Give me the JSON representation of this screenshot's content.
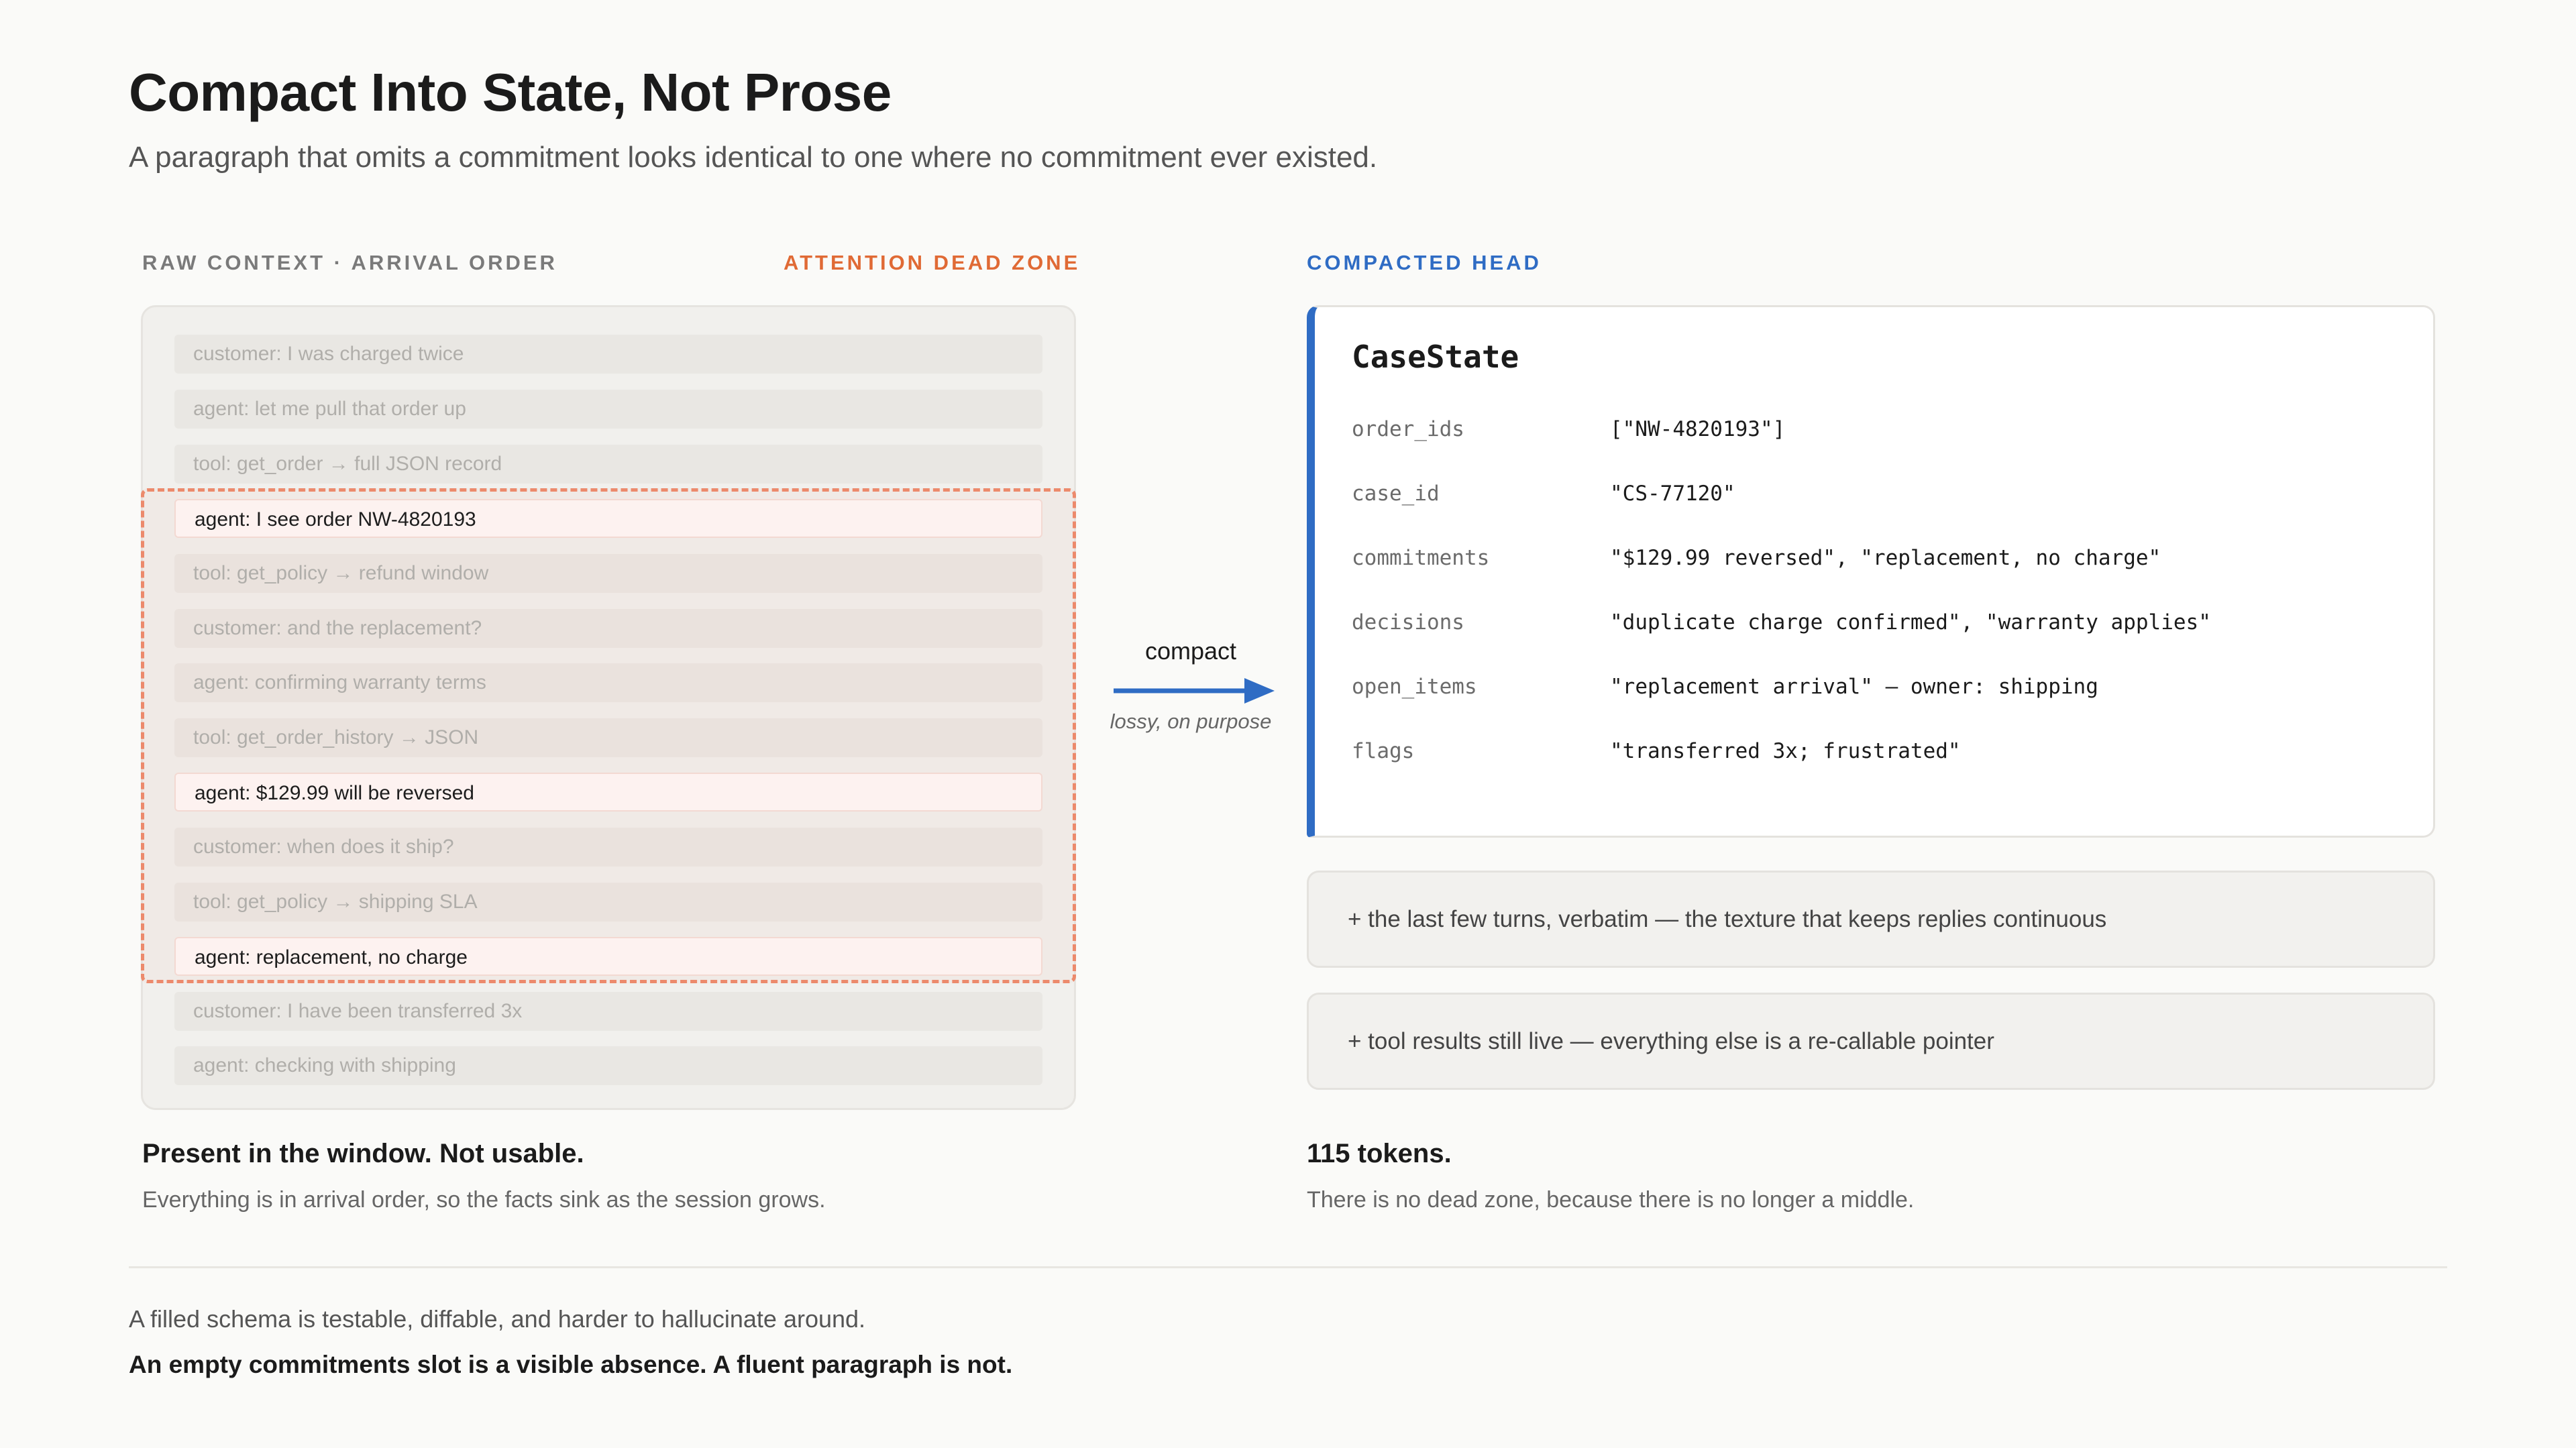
{
  "header": {
    "title": "Compact Into State, Not Prose",
    "subtitle": "A paragraph that omits a commitment looks identical to one where no commitment ever existed."
  },
  "labels": {
    "raw_context": "RAW CONTEXT · ARRIVAL ORDER",
    "dead_zone": "ATTENTION DEAD ZONE",
    "compacted_head": "COMPACTED HEAD"
  },
  "raw_rows": [
    {
      "text": "customer: I was charged twice",
      "state": "faded"
    },
    {
      "text": "agent: let me pull that order up",
      "state": "faded"
    },
    {
      "text": "tool: get_order → full JSON record",
      "state": "faded"
    },
    {
      "text": "agent: I see order NW-4820193",
      "state": "highlight"
    },
    {
      "text": "tool: get_policy → refund window",
      "state": "dead"
    },
    {
      "text": "customer: and the replacement?",
      "state": "dead"
    },
    {
      "text": "agent: confirming warranty terms",
      "state": "dead"
    },
    {
      "text": "tool: get_order_history → JSON",
      "state": "dead"
    },
    {
      "text": "agent: $129.99 will be reversed",
      "state": "highlight"
    },
    {
      "text": "customer: when does it ship?",
      "state": "dead"
    },
    {
      "text": "tool: get_policy → shipping SLA",
      "state": "dead"
    },
    {
      "text": "agent: replacement, no charge",
      "state": "highlight"
    },
    {
      "text": "customer: I have been transferred 3x",
      "state": "faded"
    },
    {
      "text": "agent: checking with shipping",
      "state": "faded"
    }
  ],
  "arrow": {
    "label": "compact",
    "note": "lossy, on purpose"
  },
  "case_state": {
    "title": "CaseState",
    "fields": [
      {
        "key": "order_ids",
        "value": "[\"NW-4820193\"]"
      },
      {
        "key": "case_id",
        "value": "\"CS-77120\""
      },
      {
        "key": "commitments",
        "value": "\"$129.99 reversed\", \"replacement, no charge\""
      },
      {
        "key": "decisions",
        "value": "\"duplicate charge confirmed\", \"warranty applies\""
      },
      {
        "key": "open_items",
        "value": "\"replacement arrival\" — owner: shipping"
      },
      {
        "key": "flags",
        "value": "\"transferred 3x; frustrated\""
      }
    ]
  },
  "extras": [
    "+ the last few turns, verbatim — the texture that keeps replies continuous",
    "+ tool results still live — everything else is a re-callable pointer"
  ],
  "captions": {
    "left_bold": "Present in the window. Not usable.",
    "left_sub": "Everything is in arrival order, so the facts sink as the session grows.",
    "right_bold": "115 tokens.",
    "right_sub": "There is no dead zone, because there is no longer a middle."
  },
  "footer": {
    "line1": "A filled schema is testable, diffable, and harder to hallucinate around.",
    "line2": "An empty commitments slot is a visible absence. A fluent paragraph is not."
  },
  "colors": {
    "accent_blue": "#2f6cc4",
    "dead_zone_orange": "#e06a35",
    "dead_zone_border": "#ec8a6c"
  }
}
